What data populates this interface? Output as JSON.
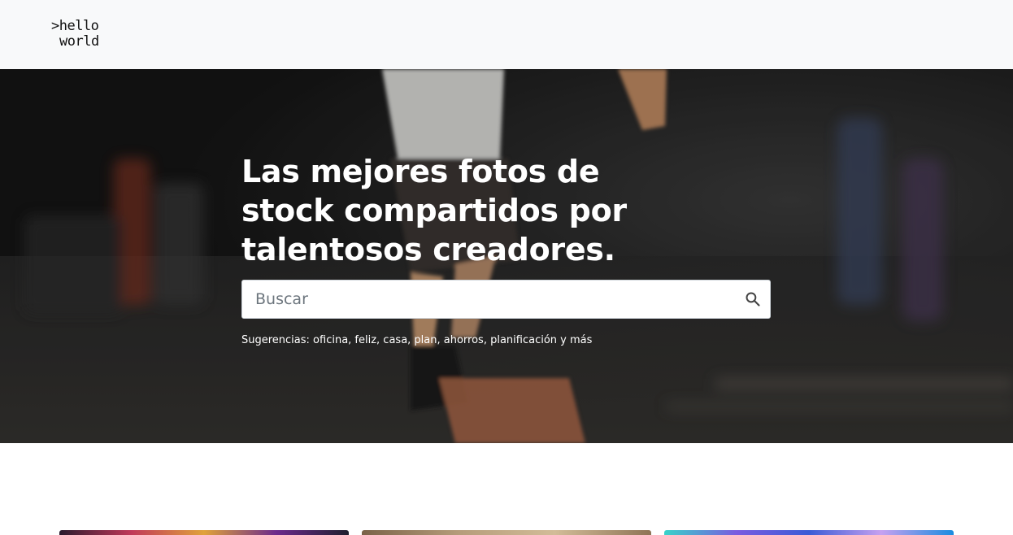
{
  "navbar": {
    "logo_line1": ">hello",
    "logo_line2": "world"
  },
  "hero": {
    "title": "Las mejores fotos de stock compartidos por talentosos creadores.",
    "search": {
      "placeholder": "Buscar",
      "value": ""
    },
    "suggestions": "Sugerencias: oficina, feliz, casa, plan, ahorros, planificación y más"
  },
  "icons": {
    "search": "search-icon"
  },
  "colors": {
    "navbar_bg": "#f8f9fa",
    "hero_text": "#ffffff"
  }
}
